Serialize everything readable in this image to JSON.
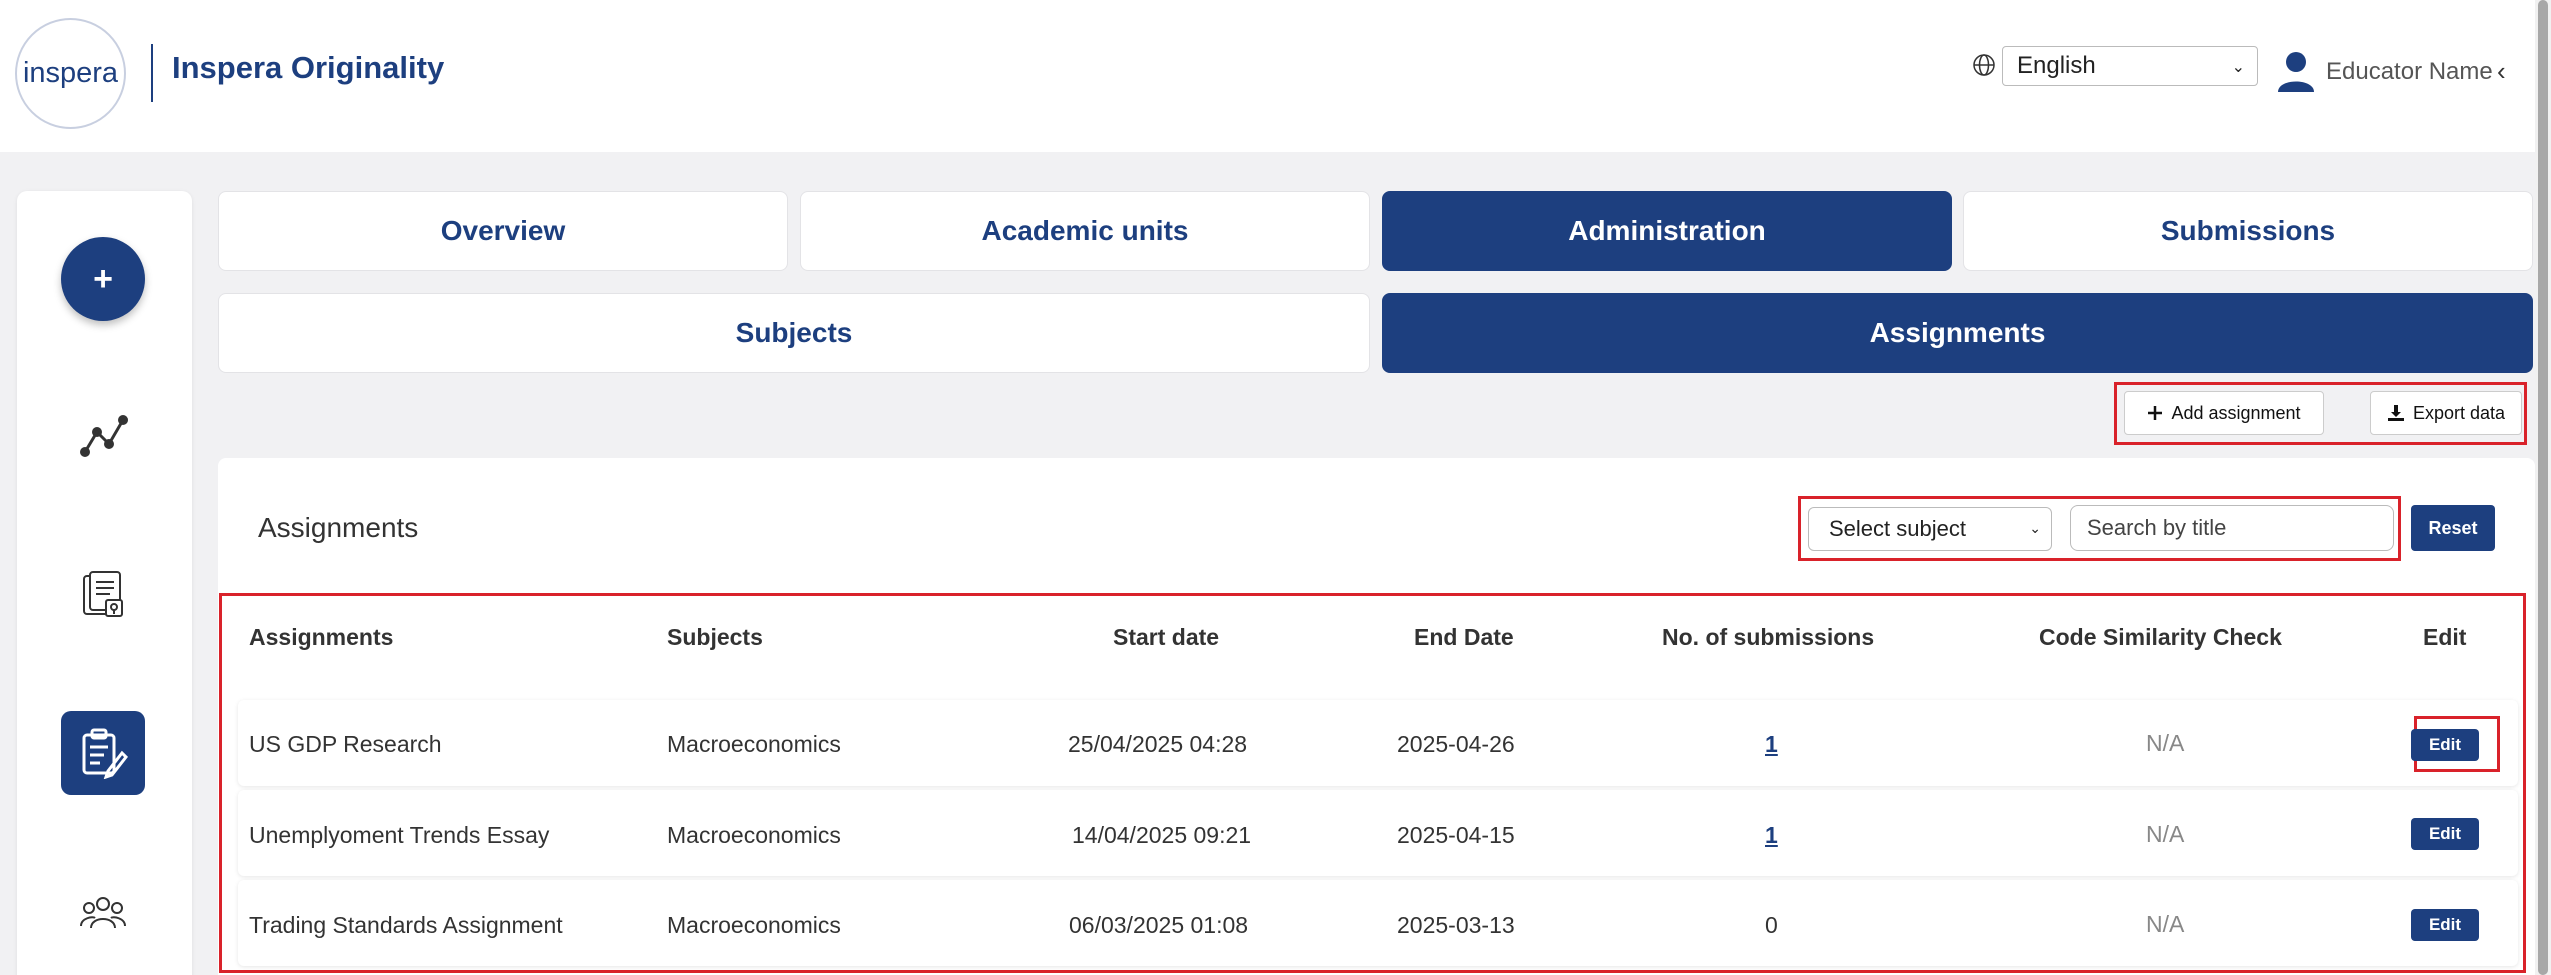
{
  "header": {
    "logo_text": "Inspera",
    "brand": "Inspera Originality",
    "language": "English",
    "user_name": "Educator Name"
  },
  "sidebar": {
    "add_label": "+",
    "items": [
      {
        "icon": "analytics-icon"
      },
      {
        "icon": "documents-icon"
      },
      {
        "icon": "assignment-edit-icon"
      },
      {
        "icon": "users-icon"
      }
    ]
  },
  "tabs": {
    "top": [
      "Overview",
      "Academic units",
      "Administration",
      "Submissions"
    ],
    "sub": [
      "Subjects",
      "Assignments"
    ]
  },
  "actions": {
    "add_assignment": "Add assignment",
    "export_data": "Export data"
  },
  "card": {
    "title": "Assignments",
    "subject_select": "Select subject",
    "search_placeholder": "Search by title",
    "reset": "Reset"
  },
  "table": {
    "columns": [
      "Assignments",
      "Subjects",
      "Start date",
      "End Date",
      "No. of submissions",
      "Code Similarity Check",
      "Edit"
    ],
    "rows": [
      {
        "assignment": "US GDP Research",
        "subject": "Macroeconomics",
        "start": "25/04/2025 04:28",
        "end": "2025-04-26",
        "submissions": "1",
        "code_check": "N/A",
        "edit": "Edit"
      },
      {
        "assignment": "Unemplyoment Trends Essay",
        "subject": "Macroeconomics",
        "start": "14/04/2025 09:21",
        "end": "2025-04-15",
        "submissions": "1",
        "code_check": "N/A",
        "edit": "Edit"
      },
      {
        "assignment": "Trading Standards Assignment",
        "subject": "Macroeconomics",
        "start": "06/03/2025 01:08",
        "end": "2025-03-13",
        "submissions": "0",
        "code_check": "N/A",
        "edit": "Edit"
      }
    ]
  },
  "colors": {
    "primary": "#1d3f7f",
    "highlight": "#d9222a",
    "background": "#f1f1f3"
  }
}
